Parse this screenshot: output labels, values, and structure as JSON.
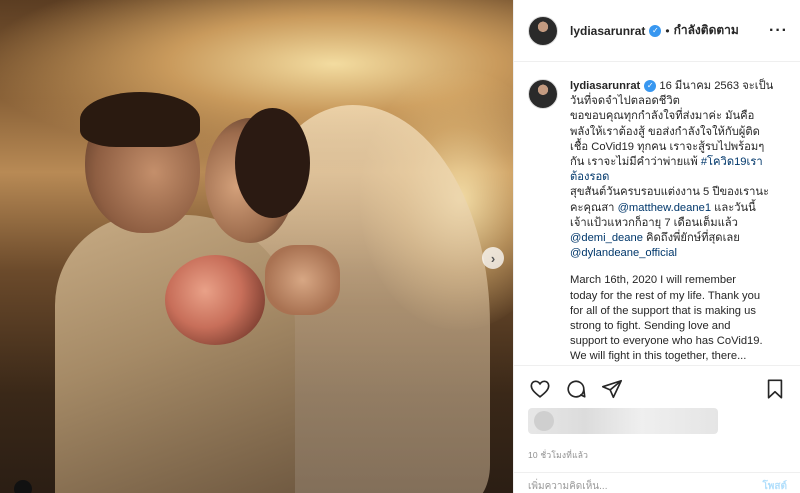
{
  "post": {
    "username": "lydiasarunrat",
    "follow_label": "กำลังติดตาม",
    "dot": "•",
    "more_label": "···",
    "verified_glyph": "✓",
    "next_glyph": "›",
    "caption_lines": [
      {
        "type": "text",
        "value": "16 มีนาคม 2563 จะเป็น"
      },
      {
        "type": "text",
        "value": "วันที่จดจำไปตลอดชีวิต"
      },
      {
        "type": "text",
        "value": "ขอขอบคุณทุกกำลังใจที่ส่งมาค่ะ มันคือ"
      },
      {
        "type": "text",
        "value": "พลังให้เราต้องสู้ ขอส่งกำลังใจให้กับผู้ติด"
      },
      {
        "type": "text",
        "value": "เชื้อ CoVid19 ทุกคน เราจะสู้รบไปพร้อมๆ"
      },
      {
        "type": "text",
        "value": "กัน เราจะไม่มีคำว่าพ่ายแพ้ "
      }
    ],
    "hashtag": "#โควิด19เรา",
    "hashtag_2": "ต้องรอด",
    "para2_a": "สุขสันต์วันครบรอบแต่งงาน 5 ปีของเรานะ",
    "para2_b": "คะคุณสา ",
    "mention1": "@matthew.deane1",
    "para2_c": " และวันนี้",
    "para2_d": "เจ้าแป้วแหวกก็อายุ 7 เดือนเต็มแล้ว",
    "mention2": "@demi_deane",
    "para2_e": " คิดถึงพี่ยักษ์ที่สุดเลย",
    "mention3": "@dylandeane_official",
    "english_lines": [
      "March 16th, 2020 I will remember",
      "today for the rest of my life. Thank you",
      "for all of the support that is making us",
      "strong to fight. Sending love and",
      "support to everyone who has CoVid19.",
      "We will fight in this together, there..."
    ],
    "time_ago": "10 ชั่วโมงที่แล้ว",
    "comment_placeholder": "เพิ่มความคิดเห็น...",
    "post_label": "โพสต์"
  },
  "icons": {
    "like": "heart-icon",
    "comment": "comment-icon",
    "share": "share-icon",
    "save": "bookmark-icon"
  }
}
